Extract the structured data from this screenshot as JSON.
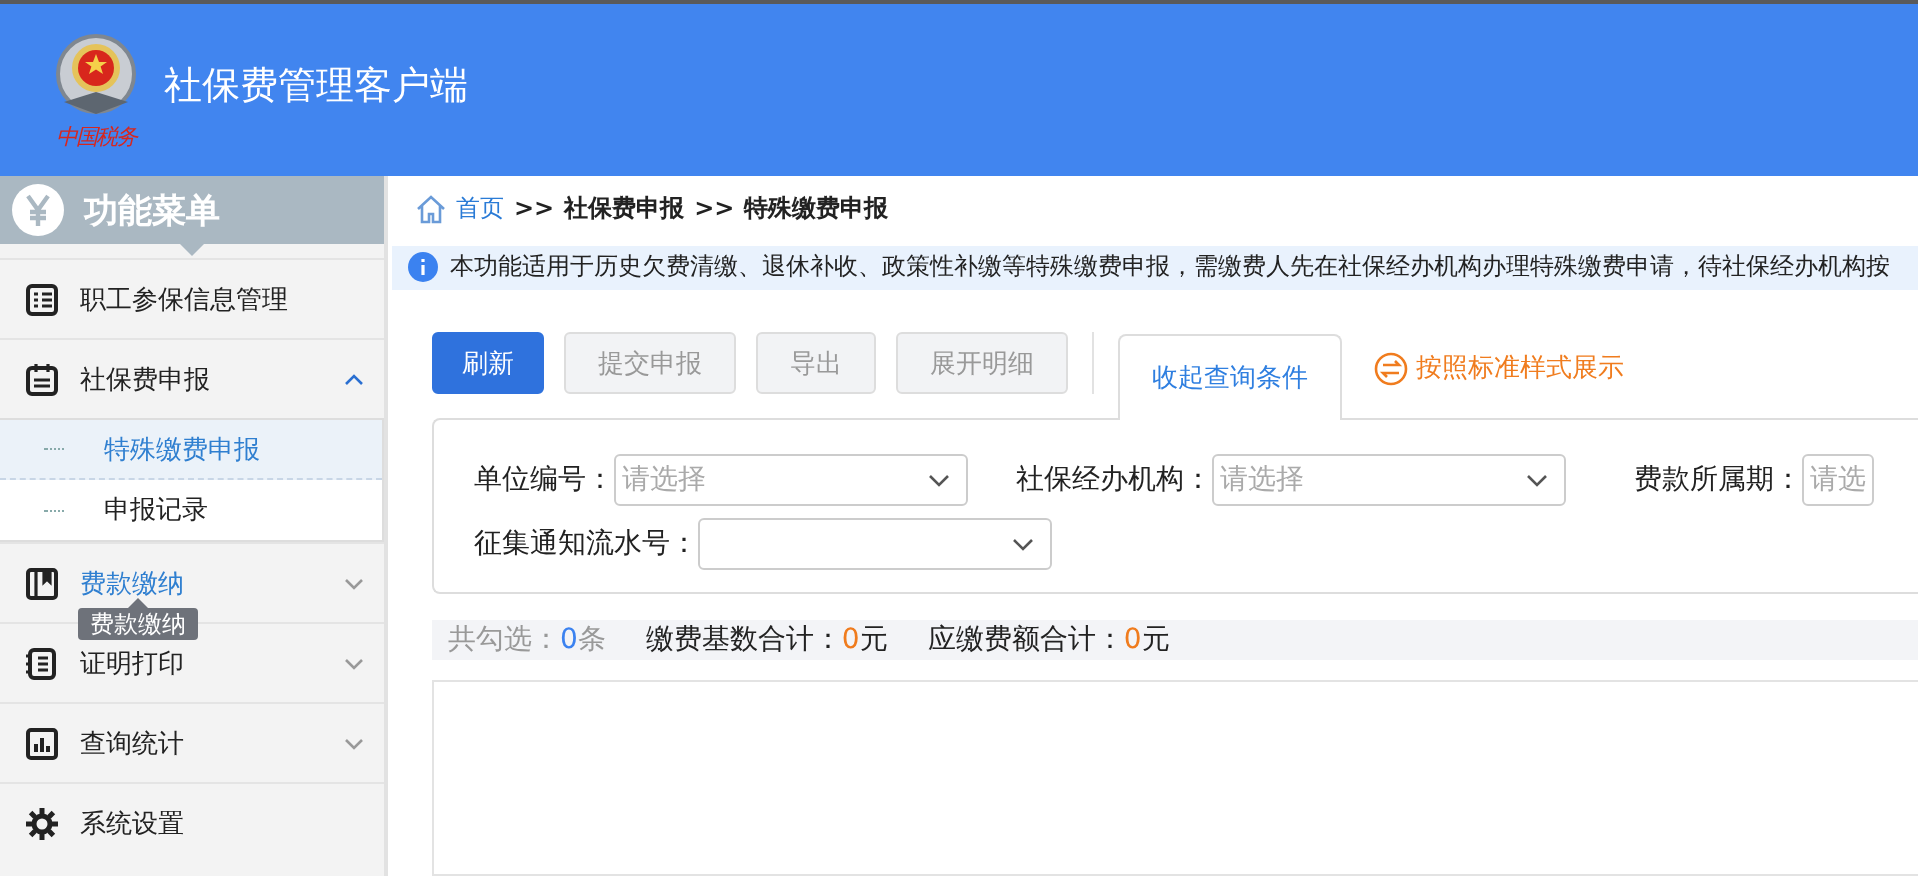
{
  "header": {
    "title": "社保费管理客户端",
    "logo_caption": "中国税务"
  },
  "sidebar": {
    "title": "功能菜单",
    "items": [
      {
        "label": "职工参保信息管理",
        "hovered": false
      },
      {
        "label": "社保费申报",
        "expanded": true,
        "hovered": false,
        "children": [
          {
            "label": "特殊缴费申报",
            "selected": true
          },
          {
            "label": "申报记录",
            "selected": false
          }
        ]
      },
      {
        "label": "费款缴纳",
        "expanded": false,
        "hovered": true
      },
      {
        "label": "证明打印",
        "expanded": false,
        "hovered": false
      },
      {
        "label": "查询统计",
        "expanded": false,
        "hovered": false
      },
      {
        "label": "系统设置",
        "hovered": false
      }
    ],
    "tooltip": "费款缴纳"
  },
  "breadcrumb": [
    {
      "label": "首页",
      "link": true
    },
    {
      "label": ">>",
      "link": false
    },
    {
      "label": "社保费申报",
      "link": false
    },
    {
      "label": ">>",
      "link": false
    },
    {
      "label": "特殊缴费申报",
      "link": false
    }
  ],
  "notice": "本功能适用于历史欠费清缴、退休补收、政策性补缴等特殊缴费申报，需缴费人先在社保经办机构办理特殊缴费申请，待社保经办机构按",
  "toolbar": [
    {
      "label": "刷新",
      "kind": "primary"
    },
    {
      "label": "提交申报",
      "kind": "disabled"
    },
    {
      "label": "导出",
      "kind": "disabled"
    },
    {
      "label": "展开明细",
      "kind": "disabled"
    }
  ],
  "tab": {
    "label": "收起查询条件",
    "selected": true
  },
  "style_link": "按照标准样式展示",
  "filters": [
    {
      "label": "单位编号：",
      "placeholder": "请选择"
    },
    {
      "label": "社保经办机构：",
      "placeholder": "请选择"
    },
    {
      "label": "费款所属期：",
      "placeholder": "请选"
    },
    {
      "label": "征集通知流水号："
    }
  ],
  "summary": [
    {
      "label": "共勾选：",
      "value": "0",
      "unit": "条",
      "kind": "count"
    },
    {
      "label": "缴费基数合计：",
      "value": "0",
      "unit": "元",
      "kind": "amount"
    },
    {
      "label": "应缴费额合计：",
      "value": "0",
      "unit": "元",
      "kind": "amount"
    }
  ]
}
